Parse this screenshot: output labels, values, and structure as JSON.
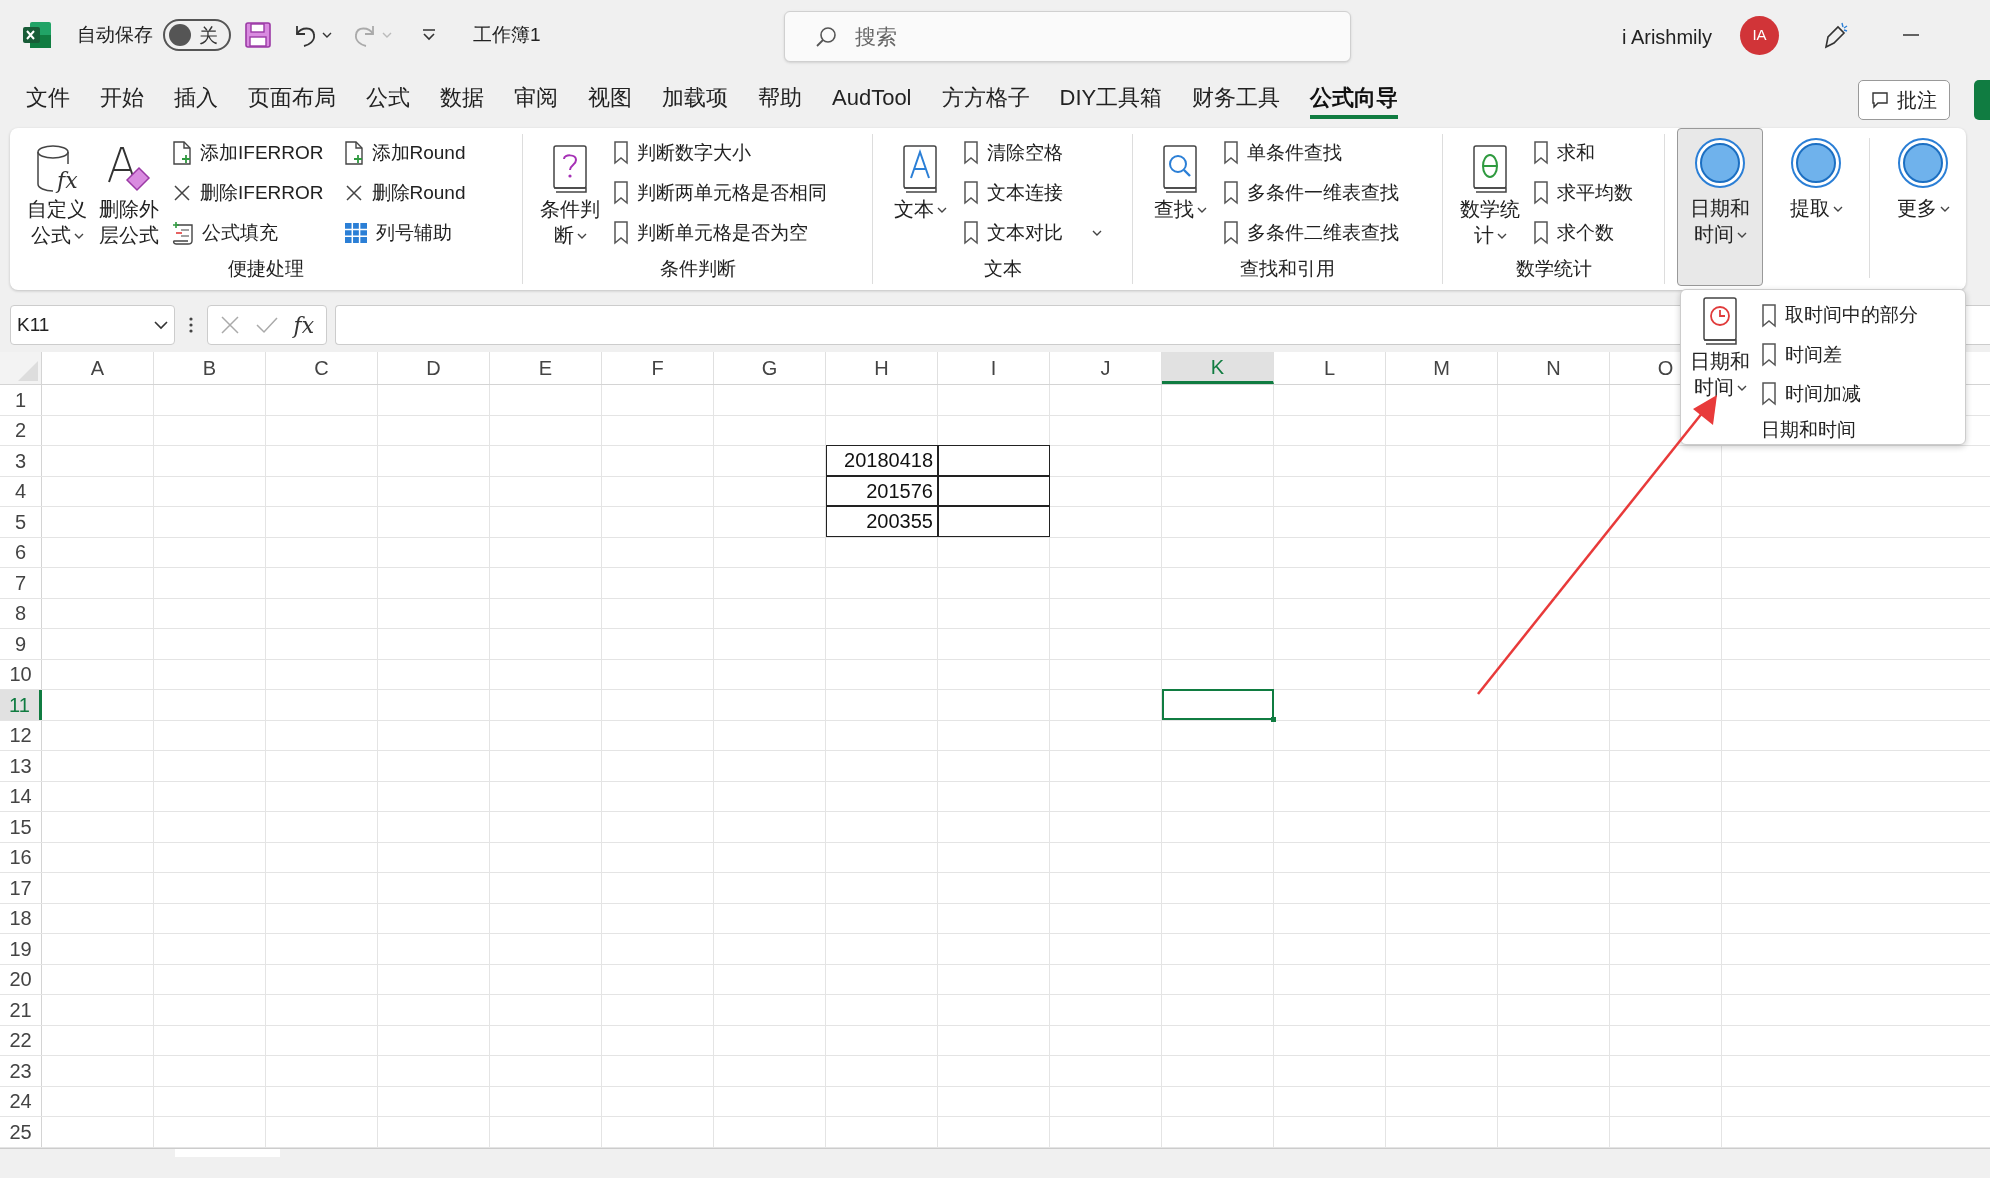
{
  "title_bar": {
    "autosave_label": "自动保存",
    "autosave_toggle": {
      "on": false,
      "label": "关"
    },
    "document_title": "工作簿1",
    "search": {
      "placeholder": "搜索"
    },
    "user_name": "i Arishmily",
    "avatar_initials": "IA"
  },
  "tabs": [
    {
      "label": "文件",
      "selected": false
    },
    {
      "label": "开始",
      "selected": false
    },
    {
      "label": "插入",
      "selected": false
    },
    {
      "label": "页面布局",
      "selected": false
    },
    {
      "label": "公式",
      "selected": false
    },
    {
      "label": "数据",
      "selected": false
    },
    {
      "label": "审阅",
      "selected": false
    },
    {
      "label": "视图",
      "selected": false
    },
    {
      "label": "加载项",
      "selected": false
    },
    {
      "label": "帮助",
      "selected": false
    },
    {
      "label": "AudTool",
      "selected": false
    },
    {
      "label": "方方格子",
      "selected": false
    },
    {
      "label": "DIY工具箱",
      "selected": false
    },
    {
      "label": "财务工具",
      "selected": false
    },
    {
      "label": "公式向导",
      "selected": true
    }
  ],
  "comment_button": "批注",
  "ribbon": {
    "groups": [
      {
        "title": "便捷处理",
        "large_buttons": [
          {
            "label": "自定义公式",
            "icon_text": "fx",
            "kind": "cylinder",
            "dropdown": true
          },
          {
            "label": "删除外层公式",
            "kind": "eraser",
            "dropdown": false
          }
        ],
        "items": [
          {
            "label": "添加IFERROR",
            "kind": "add",
            "dropdown": false
          },
          {
            "label": "删除IFERROR",
            "kind": "remove",
            "dropdown": false
          },
          {
            "label": "公式填充",
            "kind": "fill",
            "dropdown": false
          },
          {
            "label": "添加Round",
            "kind": "add",
            "dropdown": false
          },
          {
            "label": "删除Round",
            "kind": "remove",
            "dropdown": false
          },
          {
            "label": "列号辅助",
            "kind": "grid",
            "dropdown": false
          }
        ]
      },
      {
        "title": "条件判断",
        "large_buttons": [
          {
            "label": "条件判断",
            "kind": "question",
            "dropdown": true
          }
        ],
        "items": [
          {
            "label": "判断数字大小",
            "kind": "bookmark",
            "dropdown": false
          },
          {
            "label": "判断两单元格是否相同",
            "kind": "bookmark",
            "dropdown": false
          },
          {
            "label": "判断单元格是否为空",
            "kind": "bookmark",
            "dropdown": false
          }
        ]
      },
      {
        "title": "文本",
        "large_buttons": [
          {
            "label": "文本",
            "kind": "text",
            "dropdown": true
          }
        ],
        "items": [
          {
            "label": "清除空格",
            "kind": "bookmark",
            "dropdown": false
          },
          {
            "label": "文本连接",
            "kind": "bookmark",
            "dropdown": false
          },
          {
            "label": "文本对比",
            "kind": "bookmark",
            "dropdown": true
          }
        ]
      },
      {
        "title": "查找和引用",
        "large_buttons": [
          {
            "label": "查找",
            "kind": "search",
            "dropdown": true
          }
        ],
        "items": [
          {
            "label": "单条件查找",
            "kind": "bookmark",
            "dropdown": false
          },
          {
            "label": "多条件一维表查找",
            "kind": "bookmark",
            "dropdown": false
          },
          {
            "label": "多条件二维表查找",
            "kind": "bookmark",
            "dropdown": false
          }
        ]
      },
      {
        "title": "数学统计",
        "large_buttons": [
          {
            "label": "数学统计",
            "kind": "math",
            "dropdown": true
          }
        ],
        "items": [
          {
            "label": "求和",
            "kind": "bookmark",
            "dropdown": false
          },
          {
            "label": "求平均数",
            "kind": "bookmark",
            "dropdown": false
          },
          {
            "label": "求个数",
            "kind": "bookmark",
            "dropdown": false
          }
        ]
      }
    ],
    "circle_buttons": [
      {
        "label": "日期和时间",
        "selected": true,
        "dropdown": true
      },
      {
        "label": "提取",
        "selected": false,
        "dropdown": true
      },
      {
        "label": "更多",
        "selected": false,
        "dropdown": true
      }
    ]
  },
  "dropdown_menu": {
    "large_button": {
      "label": "日期和时间",
      "dropdown": true
    },
    "items": [
      "取时间中的部分",
      "时间差",
      "时间加减"
    ],
    "group_title": "日期和时间"
  },
  "formula_bar": {
    "name_box": "K11",
    "function_symbol": "fx"
  },
  "sheet": {
    "columns": [
      {
        "label": "A",
        "selected": false
      },
      {
        "label": "B",
        "selected": false
      },
      {
        "label": "C",
        "selected": false
      },
      {
        "label": "D",
        "selected": false
      },
      {
        "label": "E",
        "selected": false
      },
      {
        "label": "F",
        "selected": false
      },
      {
        "label": "G",
        "selected": false
      },
      {
        "label": "H",
        "selected": false
      },
      {
        "label": "I",
        "selected": false
      },
      {
        "label": "J",
        "selected": false
      },
      {
        "label": "K",
        "selected": true
      },
      {
        "label": "L",
        "selected": false
      },
      {
        "label": "M",
        "selected": false
      },
      {
        "label": "N",
        "selected": false
      },
      {
        "label": "O",
        "selected": false
      }
    ],
    "rows": [
      {
        "label": "1",
        "selected": false
      },
      {
        "label": "2",
        "selected": false
      },
      {
        "label": "3",
        "selected": false
      },
      {
        "label": "4",
        "selected": false
      },
      {
        "label": "5",
        "selected": false
      },
      {
        "label": "6",
        "selected": false
      },
      {
        "label": "7",
        "selected": false
      },
      {
        "label": "8",
        "selected": false
      },
      {
        "label": "9",
        "selected": false
      },
      {
        "label": "10",
        "selected": false
      },
      {
        "label": "11",
        "selected": true
      },
      {
        "label": "12",
        "selected": false
      },
      {
        "label": "13",
        "selected": false
      },
      {
        "label": "14",
        "selected": false
      },
      {
        "label": "15",
        "selected": false
      },
      {
        "label": "16",
        "selected": false
      },
      {
        "label": "17",
        "selected": false
      },
      {
        "label": "18",
        "selected": false
      },
      {
        "label": "19",
        "selected": false
      },
      {
        "label": "20",
        "selected": false
      },
      {
        "label": "21",
        "selected": false
      },
      {
        "label": "22",
        "selected": false
      },
      {
        "label": "23",
        "selected": false
      },
      {
        "label": "24",
        "selected": false
      },
      {
        "label": "25",
        "selected": false
      }
    ],
    "bordered_range": {
      "values": [
        "20180418",
        "201576",
        "200355"
      ]
    }
  }
}
